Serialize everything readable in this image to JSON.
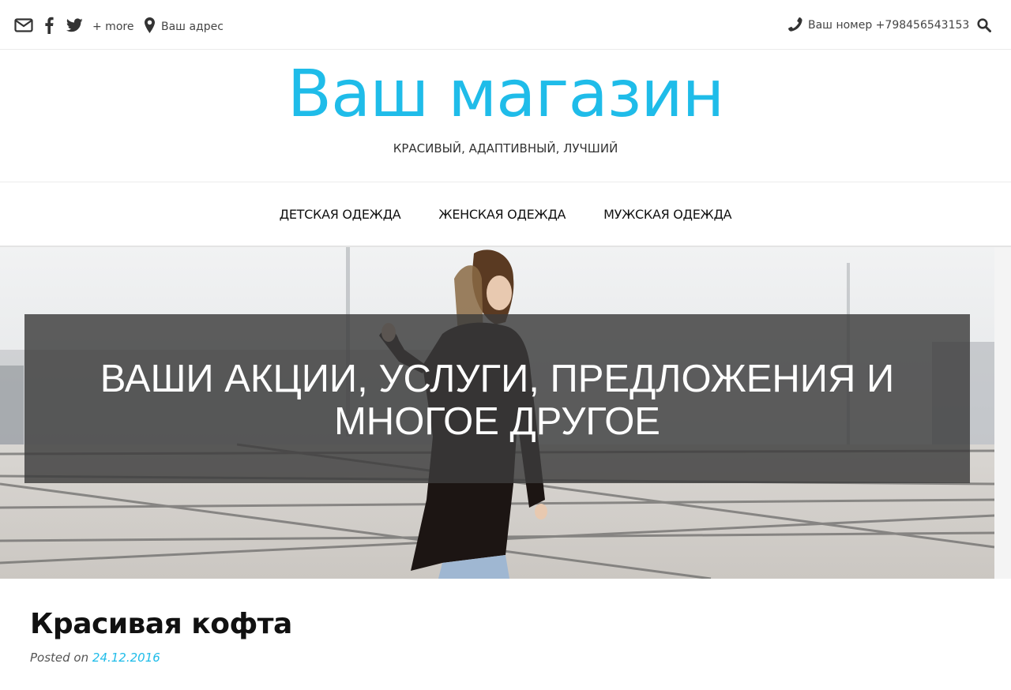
{
  "topbar": {
    "more_label": "+ more",
    "address": "Ваш адрес",
    "phone": "Ваш номер +798456543153",
    "icons": [
      "envelope-icon",
      "facebook-icon",
      "twitter-icon",
      "map-marker-icon",
      "phone-icon",
      "search-icon"
    ]
  },
  "branding": {
    "site_title": "Ваш магазин",
    "tagline": "КРАСИВЫЙ, АДАПТИВНЫЙ, ЛУЧШИЙ"
  },
  "nav": {
    "items": [
      {
        "label": "ДЕТСКАЯ ОДЕЖДА"
      },
      {
        "label": "ЖЕНСКАЯ ОДЕЖДА"
      },
      {
        "label": "МУЖСКАЯ ОДЕЖДА"
      }
    ]
  },
  "hero": {
    "caption": "ВАШИ АКЦИИ, УСЛУГИ, ПРЕДЛОЖЕНИЯ И МНОГОЕ ДРУГОЕ"
  },
  "post": {
    "title": "Красивая кофта",
    "posted_on": "Posted on",
    "date": "24.12.2016"
  },
  "colors": {
    "accent": "#1fbce9",
    "text": "#333333",
    "caption_bg": "#3c3c3c"
  }
}
